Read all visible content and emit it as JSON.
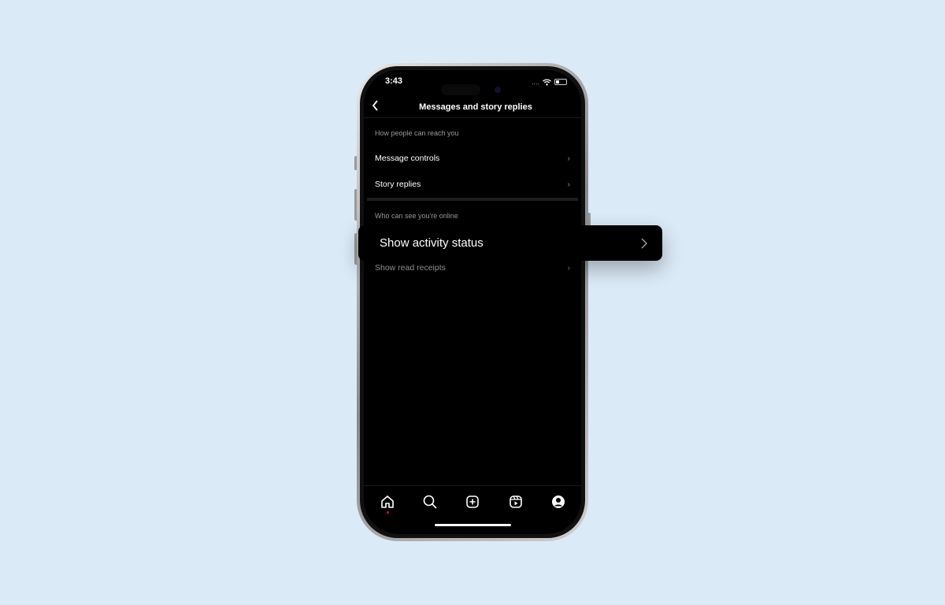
{
  "status_bar": {
    "time": "3:43",
    "signal": "....",
    "wifi_icon": "wifi-icon",
    "battery_icon": "battery-icon"
  },
  "header": {
    "title": "Messages and story replies",
    "back_icon": "chevron-left-icon"
  },
  "sections": [
    {
      "title": "How people can reach you",
      "items": [
        {
          "label": "Message controls"
        },
        {
          "label": "Story replies"
        }
      ]
    },
    {
      "title": "Who can see you're online",
      "items": [
        {
          "label": "Show activity status"
        },
        {
          "label": "Show read receipts"
        }
      ]
    }
  ],
  "callout": {
    "label": "Show activity status"
  },
  "tab_bar": {
    "items": [
      "home-icon",
      "search-icon",
      "create-icon",
      "reels-icon",
      "profile-icon"
    ],
    "active": "home-icon",
    "notification_color": "#e0102a"
  }
}
